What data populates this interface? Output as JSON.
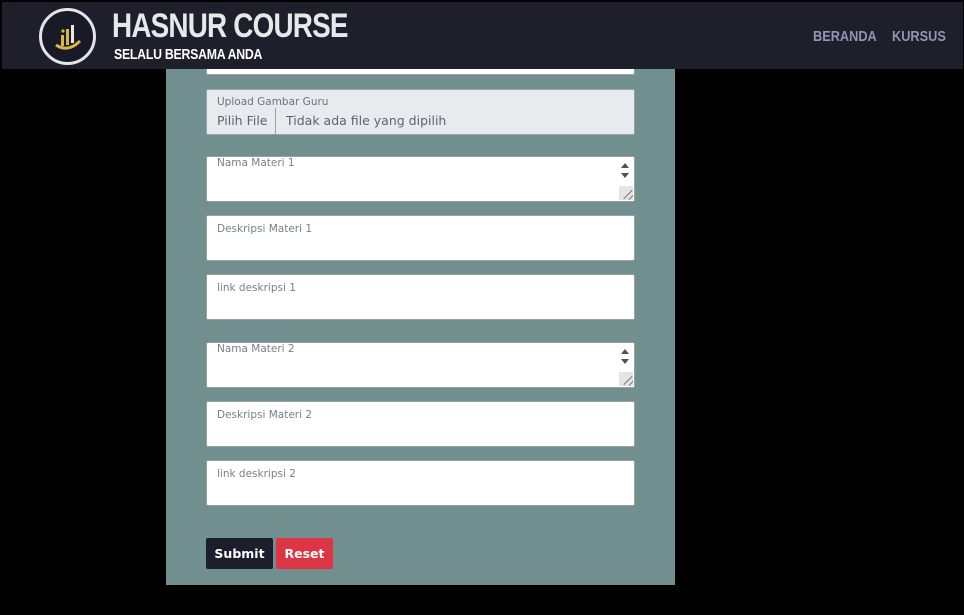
{
  "header": {
    "brand_title": "HASNUR COURSE",
    "brand_subtitle": "SELALU BERSAMA ANDA",
    "nav": [
      {
        "label": "BERANDA"
      },
      {
        "label": "KURSUS"
      }
    ],
    "logo_icon": "hasnur-logo-icon"
  },
  "form": {
    "upload": {
      "label": "Upload Gambar Guru",
      "button_label": "Pilih File",
      "status": "Tidak ada file yang dipilih"
    },
    "fields": [
      {
        "label": "Nama Materi 1"
      },
      {
        "label": "Deskripsi Materi 1"
      },
      {
        "label": "link deskripsi 1"
      },
      {
        "label": "Nama Materi 2"
      },
      {
        "label": "Deskripsi Materi 2"
      },
      {
        "label": "link deskripsi 2"
      }
    ],
    "submit_label": "Submit",
    "reset_label": "Reset"
  },
  "colors": {
    "navbar": "#1d1f2b",
    "panel": "#728f8f",
    "nav_link": "#8f96b3",
    "submit": "#1c1f2b",
    "reset": "#dc3545"
  }
}
